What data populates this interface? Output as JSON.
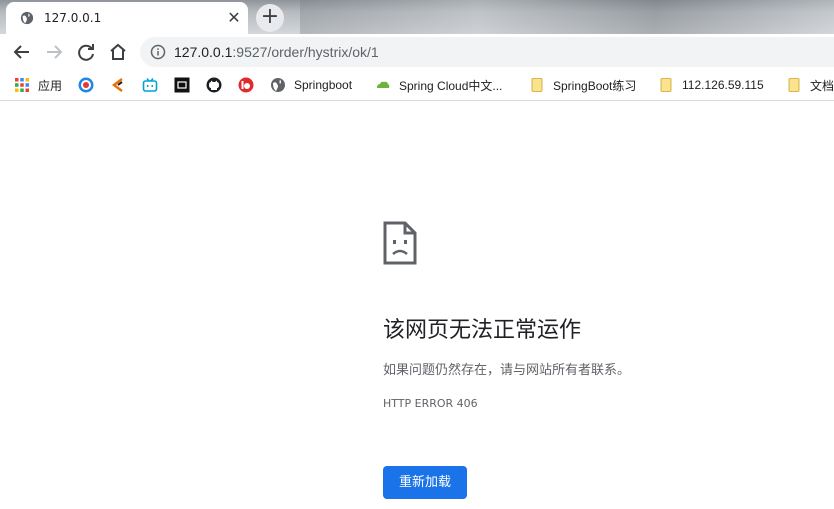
{
  "tab": {
    "title": "127.0.0.1",
    "close_glyph": "✕",
    "new_tab_glyph": "+",
    "icon": "globe-icon"
  },
  "toolbar": {
    "back_icon": "arrow-left-icon",
    "forward_icon": "arrow-right-icon",
    "reload_icon": "reload-icon",
    "home_icon": "home-icon",
    "url_host": "127.0.0.1",
    "url_path": ":9527/order/hystrix/ok/1"
  },
  "bookmarks": [
    {
      "label": "应用",
      "icon": "apps-grid-icon"
    },
    {
      "label": "",
      "icon": "colorful-wheel-icon"
    },
    {
      "label": "",
      "icon": "tool-icon"
    },
    {
      "label": "",
      "icon": "bilibili-icon"
    },
    {
      "label": "",
      "icon": "black-square-icon"
    },
    {
      "label": "",
      "icon": "github-icon"
    },
    {
      "label": "",
      "icon": "red-circle-icon"
    },
    {
      "label": "Springboot",
      "icon": "globe-icon"
    },
    {
      "label": "Spring Cloud中文...",
      "icon": "cloud-icon"
    },
    {
      "label": "SpringBoot练习",
      "icon": "folder-icon"
    },
    {
      "label": "112.126.59.115",
      "icon": "folder-icon"
    },
    {
      "label": "文档",
      "icon": "folder-icon"
    }
  ],
  "error": {
    "icon": "sad-page-icon",
    "title": "该网页无法正常运作",
    "message": "如果问题仍然存在，请与网站所有者联系。",
    "code": "HTTP ERROR 406",
    "reload_label": "重新加载"
  },
  "colors": {
    "accent": "#1a73e8",
    "omnibox": "#f1f3f4",
    "text": "#202124",
    "muted": "#5f6368"
  }
}
